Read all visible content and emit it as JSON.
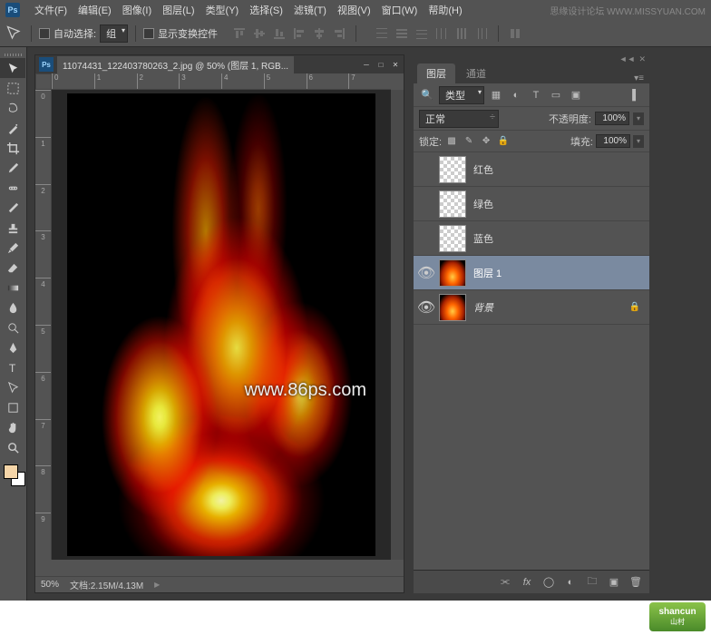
{
  "menubar": {
    "items": [
      "文件(F)",
      "编辑(E)",
      "图像(I)",
      "图层(L)",
      "类型(Y)",
      "选择(S)",
      "滤镜(T)",
      "视图(V)",
      "窗口(W)",
      "帮助(H)"
    ],
    "brand": "思缘设计论坛   WWW.MISSYUAN.COM"
  },
  "options": {
    "auto_select": "自动选择:",
    "group": "组",
    "show_transform": "显示变换控件"
  },
  "document": {
    "title": "11074431_122403780263_2.jpg @ 50% (图层 1, RGB...",
    "zoom": "50%",
    "filesize": "文档:2.15M/4.13M",
    "ruler_h": [
      "0",
      "1",
      "2",
      "3",
      "4",
      "5",
      "6",
      "7"
    ],
    "ruler_v": [
      "0",
      "1",
      "2",
      "3",
      "4",
      "5",
      "6",
      "7",
      "8",
      "9"
    ],
    "watermark": "www.86ps.com"
  },
  "layers_panel": {
    "tab_layers": "图层",
    "tab_channels": "通道",
    "filter_kind": "类型",
    "blend_mode": "正常",
    "opacity_label": "不透明度:",
    "opacity_value": "100%",
    "lock_label": "锁定:",
    "fill_label": "填充:",
    "fill_value": "100%",
    "layers": [
      {
        "visible": false,
        "name": "红色",
        "thumb": "checker"
      },
      {
        "visible": false,
        "name": "绿色",
        "thumb": "checker"
      },
      {
        "visible": false,
        "name": "蓝色",
        "thumb": "checker"
      },
      {
        "visible": true,
        "name": "图层 1",
        "thumb": "fire",
        "selected": true
      },
      {
        "visible": true,
        "name": "背景",
        "thumb": "fire",
        "locked": true,
        "italic": true
      }
    ]
  },
  "logo": {
    "text": "shancun",
    "sub": "山村"
  }
}
